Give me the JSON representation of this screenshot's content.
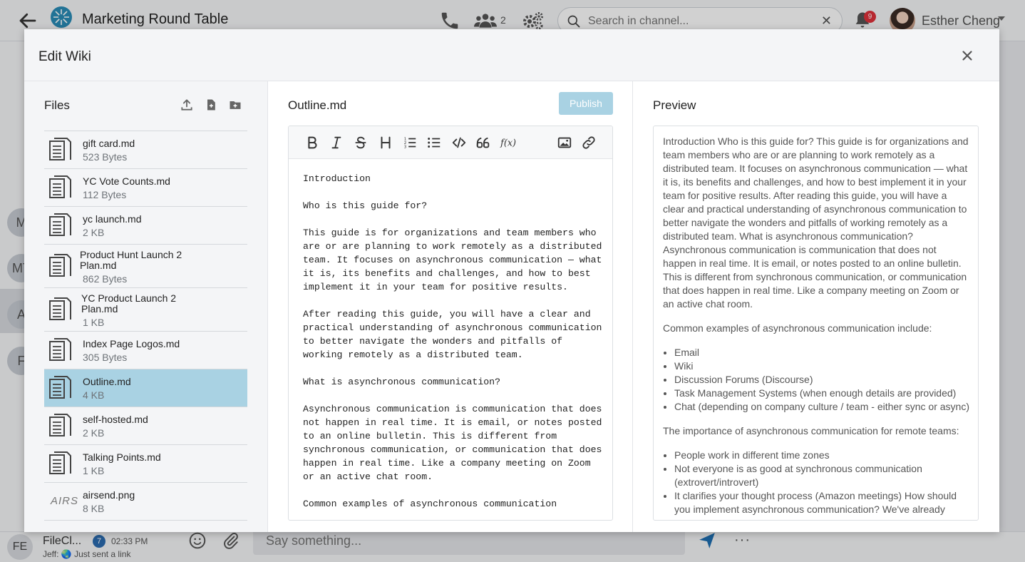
{
  "app": {
    "channel_title": "Marketing Round Table",
    "member_count": "2",
    "search_placeholder": "Search in channel...",
    "notification_count": "9",
    "user_name": "Esther Cheng"
  },
  "rail": {
    "initials": [
      "M",
      "MT",
      "A",
      "F"
    ]
  },
  "bottom": {
    "avatar_initials": "FE",
    "chat_name": "FileCl...",
    "chat_badge": "7",
    "chat_time": "02:33 PM",
    "chat_preview": "Jeff: 🌏 Just sent a link",
    "message_placeholder": "Say something...",
    "more": "···"
  },
  "modal": {
    "title": "Edit Wiki",
    "files_title": "Files",
    "editor_title": "Outline.md",
    "publish_label": "Publish",
    "preview_title": "Preview"
  },
  "files": [
    {
      "name": "gift card.md",
      "size": "523 Bytes"
    },
    {
      "name": "YC Vote Counts.md",
      "size": "112 Bytes"
    },
    {
      "name": "yc launch.md",
      "size": "2 KB"
    },
    {
      "name": "Product Hunt Launch 2 Plan.md",
      "size": "862 Bytes"
    },
    {
      "name": "YC Product Launch 2 Plan.md",
      "size": "1 KB"
    },
    {
      "name": "Index Page Logos.md",
      "size": "305 Bytes"
    },
    {
      "name": "Outline.md",
      "size": "4 KB"
    },
    {
      "name": "self-hosted.md",
      "size": "2 KB"
    },
    {
      "name": "Talking Points.md",
      "size": "1 KB"
    },
    {
      "name": "airsend.png",
      "size": "8 KB",
      "thumb_text": "AIRS"
    }
  ],
  "editor_text": "Introduction\n\nWho is this guide for?\n\nThis guide is for organizations and team members who are or are planning to work remotely as a distributed team. It focuses on asynchronous communication — what it is, its benefits and challenges, and how to best implement it in your team for positive results.\n\nAfter reading this guide, you will have a clear and practical understanding of asynchronous communication to better navigate the wonders and pitfalls of working remotely as a distributed team.\n\nWhat is asynchronous communication?\n\nAsynchronous communication is communication that does not happen in real time. It is email, or notes posted to an online bulletin. This is different from synchronous communication, or communication that does happen in real time. Like a company meeting on Zoom or an active chat room.\n\nCommon examples of asynchronous communication",
  "preview": {
    "p1": "Introduction   Who is this guide for?   This guide is for organizations and team members who are or are planning to work remotely as a distributed team. It focuses on asynchronous communication — what it is, its benefits and challenges, and how to best implement it in your team for positive results.   After reading this guide, you will have a clear and practical understanding of asynchronous communication to better navigate the wonders and pitfalls of working remotely as a distributed team.   What is asynchronous communication?   Asynchronous communication is communication that does not happen in real time. It is email, or notes posted to an online bulletin. This is different from synchronous communication, or communication that does happen in real time. Like a company meeting on Zoom or an active chat room.",
    "p2": "Common examples of asynchronous communication include:",
    "list1": [
      "Email",
      "Wiki",
      "Discussion Forums (Discourse)",
      "Task Management Systems (when enough details are provided)",
      "Chat (depending on company culture / team - either sync or async)"
    ],
    "p3": "The importance of asynchronous communication for remote teams:",
    "list2": [
      "People work in different time zones",
      "Not everyone is as good at synchronous communication (extrovert/introvert)",
      "It clarifies your thought process (Amazon meetings)   How should you implement asynchronous communication?   We've already"
    ]
  },
  "colors": {
    "selected_row": "#a9d2e3",
    "publish_button": "#a9d2e3",
    "badge_red": "#e0313b"
  }
}
